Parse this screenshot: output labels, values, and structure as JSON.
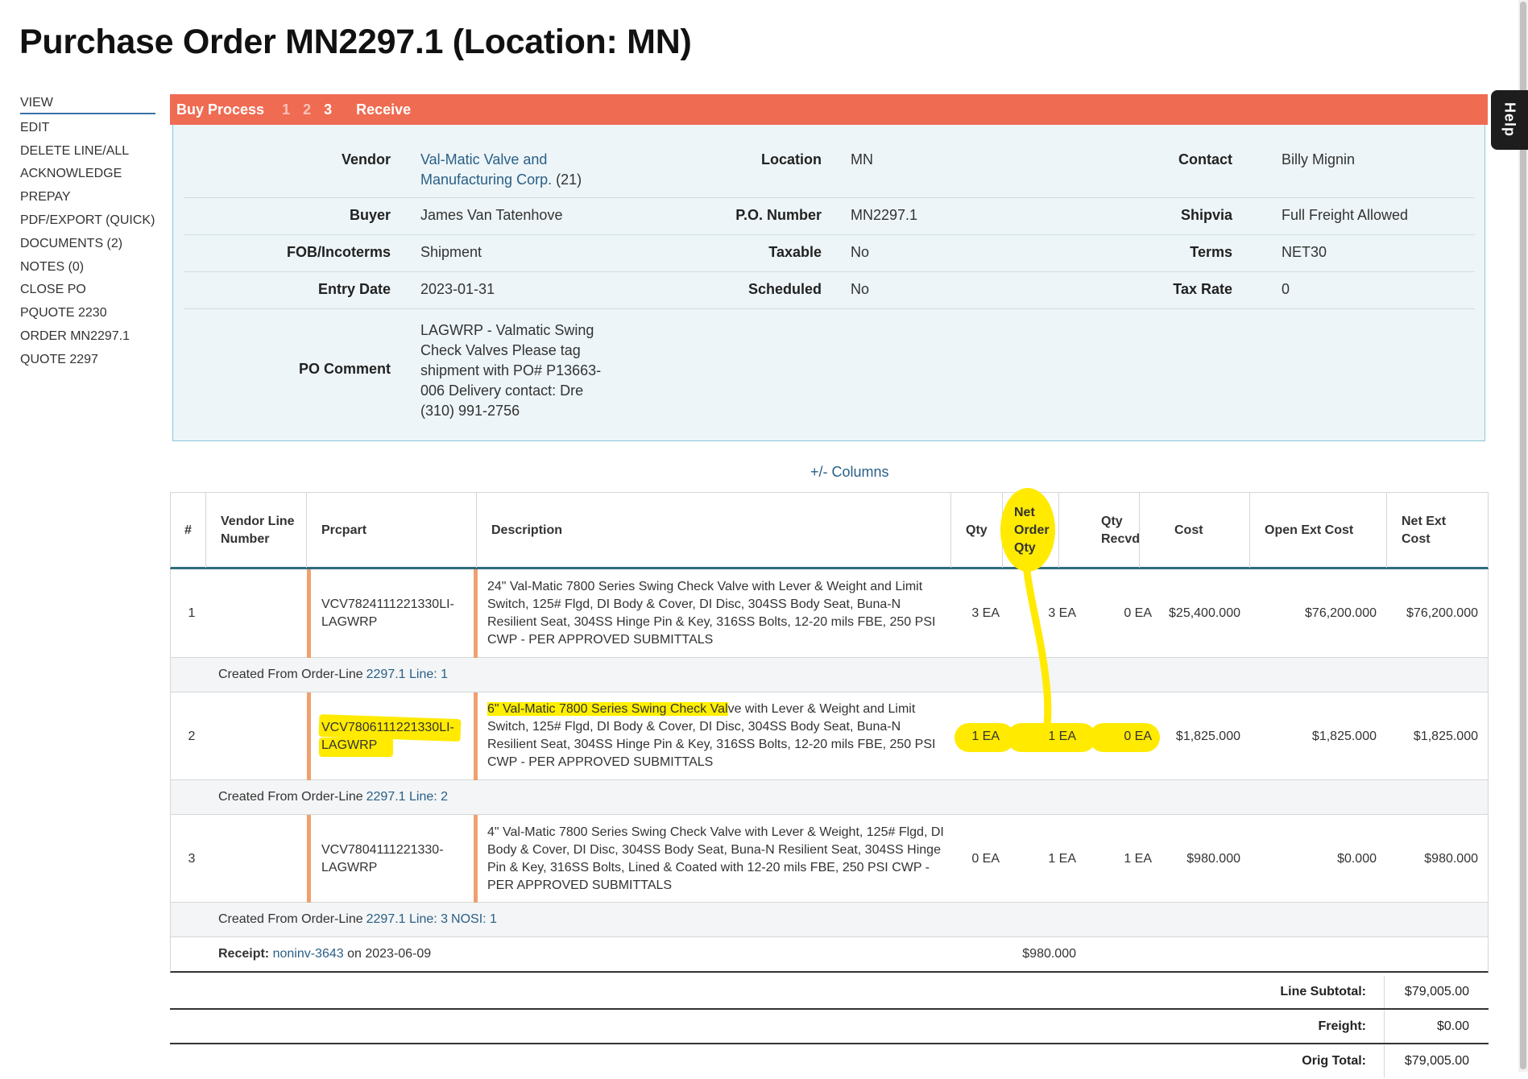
{
  "title": "Purchase Order MN2297.1 (Location: MN)",
  "sidebar": {
    "items": [
      "VIEW",
      "EDIT",
      "DELETE LINE/ALL",
      "ACKNOWLEDGE",
      "PREPAY",
      "PDF/EXPORT (QUICK)",
      "DOCUMENTS (2)",
      "NOTES (0)",
      "CLOSE PO",
      "PQUOTE 2230",
      "ORDER MN2297.1",
      "QUOTE 2297"
    ],
    "active": "VIEW"
  },
  "help": "Help",
  "buy_process": {
    "label": "Buy Process",
    "steps": [
      "1",
      "2",
      "3"
    ],
    "current_step": "3",
    "receive": "Receive"
  },
  "info": {
    "vendor_label": "Vendor",
    "vendor_name": "Val-Matic Valve and Manufacturing Corp.",
    "vendor_id": "(21)",
    "location_label": "Location",
    "location": "MN",
    "contact_label": "Contact",
    "contact": "Billy Mignin",
    "buyer_label": "Buyer",
    "buyer": "James Van Tatenhove",
    "po_number_label": "P.O. Number",
    "po_number": "MN2297.1",
    "shipvia_label": "Shipvia",
    "shipvia": "Full Freight Allowed",
    "fob_label": "FOB/Incoterms",
    "fob": "Shipment",
    "taxable_label": "Taxable",
    "taxable": "No",
    "terms_label": "Terms",
    "terms": "NET30",
    "entry_date_label": "Entry Date",
    "entry_date": "2023-01-31",
    "scheduled_label": "Scheduled",
    "scheduled": "No",
    "tax_rate_label": "Tax Rate",
    "tax_rate": "0",
    "po_comment_label": "PO Comment",
    "po_comment": "LAGWRP - Valmatic Swing Check Valves Please tag shipment with PO# P13663-006 Delivery contact: Dre (310) 991-2756"
  },
  "columns_toggle": "+/- Columns",
  "table": {
    "headers": {
      "num": "#",
      "vendor_line": "Vendor Line Number",
      "prcpart": "Prcpart",
      "description": "Description",
      "qty": "Qty",
      "net_order_qty": "Net Order Qty",
      "qty_recvd": "Qty Recvd",
      "cost": "Cost",
      "open_ext_cost": "Open Ext Cost",
      "net_ext_cost": "Net Ext Cost"
    },
    "rows": [
      {
        "num": "1",
        "prcpart": "VCV7824111221330LI-LAGWRP",
        "description": "24\" Val-Matic 7800 Series Swing Check Valve with Lever & Weight and Limit Switch, 125# Flgd, DI Body & Cover, DI Disc, 304SS Body Seat, Buna-N Resilient Seat, 304SS Hinge Pin & Key, 316SS Bolts, 12-20 mils FBE, 250 PSI CWP - PER APPROVED SUBMITTALS",
        "qty": "3 EA",
        "net_order_qty": "3 EA",
        "qty_recvd": "0 EA",
        "cost": "$25,400.000",
        "open_ext_cost": "$76,200.000",
        "net_ext_cost": "$76,200.000",
        "created_prefix": "Created From Order-Line",
        "created_link": "2297.1 Line: 1"
      },
      {
        "num": "2",
        "prcpart": "VCV7806111221330LI-LAGWRP",
        "desc_highlighted": "6\" Val-Matic 7800 Series Swing Check Val",
        "desc_rest": "ve with Lever & Weight and Limit Switch, 125# Flgd, DI Body & Cover, DI Disc, 304SS Body Seat, Buna-N Resilient Seat, 304SS Hinge Pin & Key, 316SS Bolts, 12-20 mils FBE, 250 PSI CWP - PER APPROVED SUBMITTALS",
        "qty": "1 EA",
        "net_order_qty": "1 EA",
        "qty_recvd": "0 EA",
        "cost": "$1,825.000",
        "open_ext_cost": "$1,825.000",
        "net_ext_cost": "$1,825.000",
        "created_prefix": "Created From Order-Line",
        "created_link": "2297.1 Line: 2"
      },
      {
        "num": "3",
        "prcpart": "VCV7804111221330-LAGWRP",
        "description": "4\" Val-Matic 7800 Series Swing Check Valve with Lever & Weight, 125# Flgd, DI Body & Cover, DI Disc, 304SS Body Seat, Buna-N Resilient Seat, 304SS Hinge Pin & Key, 316SS Bolts, Lined & Coated with 12-20 mils FBE, 250 PSI CWP - PER APPROVED SUBMITTALS",
        "qty": "0 EA",
        "net_order_qty": "1 EA",
        "qty_recvd": "1 EA",
        "cost": "$980.000",
        "open_ext_cost": "$0.000",
        "net_ext_cost": "$980.000",
        "created_prefix": "Created From Order-Line",
        "created_link": "2297.1 Line: 3",
        "created_link2": "NOSI: 1"
      }
    ],
    "receipt": {
      "label": "Receipt:",
      "link": "noninv-3643",
      "on_text": "on 2023-06-09",
      "amount": "$980.000"
    }
  },
  "totals": [
    {
      "label": "Line Subtotal:",
      "value": "$79,005.00"
    },
    {
      "label": "Freight:",
      "value": "$0.00"
    },
    {
      "label": "Orig Total:",
      "value": "$79,005.00"
    }
  ],
  "colors": {
    "accent_bar": "#ef6b52",
    "link": "#2a5f86",
    "highlighter": "#ffea00",
    "panel_bg": "#edf5f8"
  }
}
